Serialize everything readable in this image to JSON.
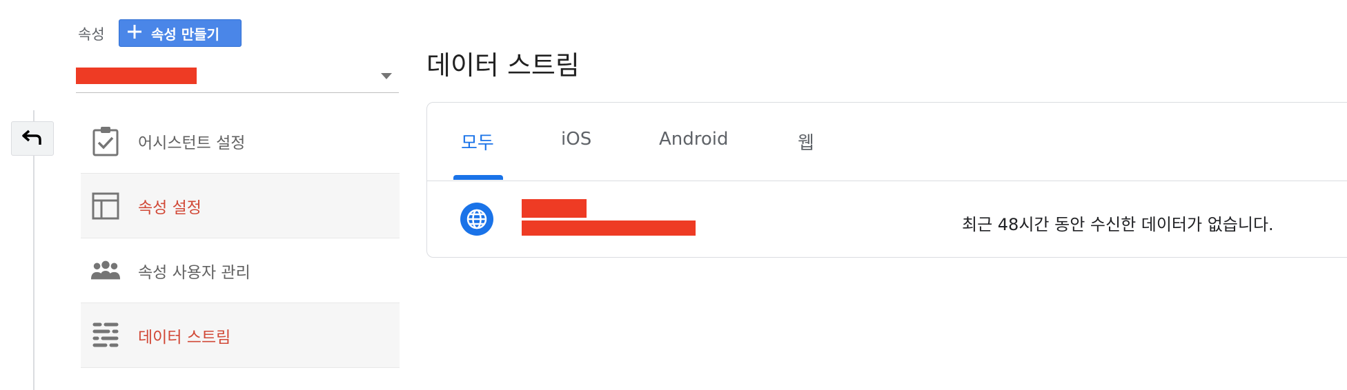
{
  "header": {
    "property_label": "속성",
    "create_button_label": "속성 만들기"
  },
  "property_selector": {
    "value": ""
  },
  "menu": {
    "items": [
      {
        "label": "어시스턴트 설정",
        "icon": "assignment-check-icon",
        "active": false
      },
      {
        "label": "속성 설정",
        "icon": "layout-icon",
        "active": true
      },
      {
        "label": "속성 사용자 관리",
        "icon": "people-icon",
        "active": false
      },
      {
        "label": "데이터 스트림",
        "icon": "data-stream-icon",
        "active": true
      }
    ]
  },
  "main": {
    "title": "데이터 스트림",
    "tabs": [
      {
        "label": "모두",
        "selected": true
      },
      {
        "label": "iOS",
        "selected": false
      },
      {
        "label": "Android",
        "selected": false
      },
      {
        "label": "웹",
        "selected": false
      }
    ],
    "streams": [
      {
        "name": "",
        "url": "",
        "icon": "globe-icon",
        "status": "최근 48시간 동안 수신한 데이터가 없습니다."
      }
    ]
  },
  "colors": {
    "accent": "#1a73e8",
    "button_blue": "#4a86e8",
    "menu_active_text": "#d14836",
    "redaction": "#ee3b24"
  }
}
